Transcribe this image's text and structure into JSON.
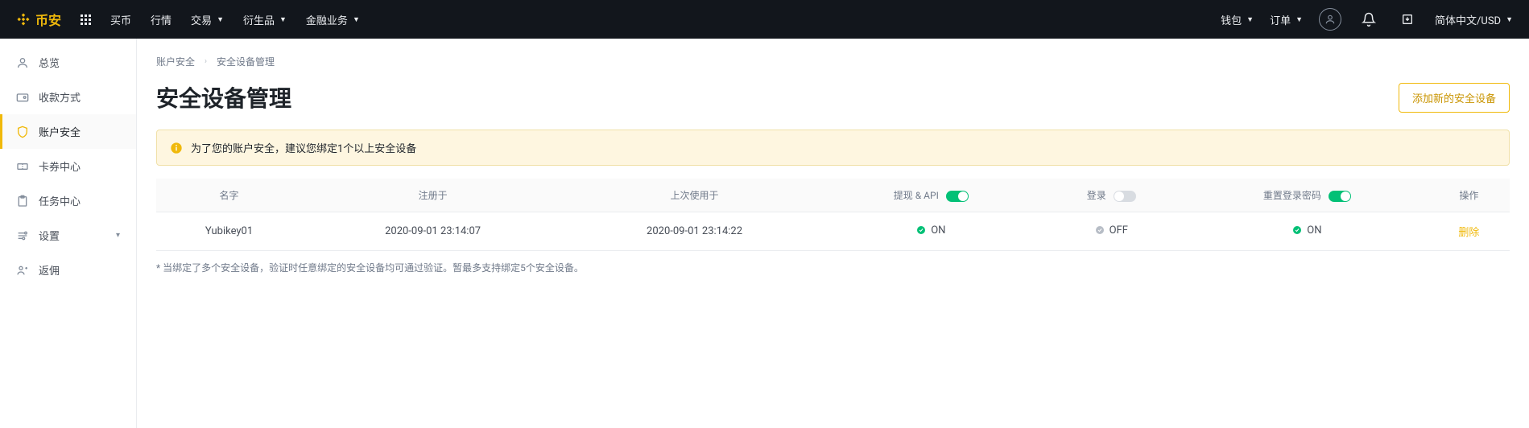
{
  "header": {
    "brand": "币安",
    "nav": [
      "买币",
      "行情",
      "交易",
      "衍生品",
      "金融业务"
    ],
    "wallet": "钱包",
    "orders": "订单",
    "locale": "简体中文/USD"
  },
  "sidebar": {
    "items": [
      {
        "label": "总览"
      },
      {
        "label": "收款方式"
      },
      {
        "label": "账户安全"
      },
      {
        "label": "卡券中心"
      },
      {
        "label": "任务中心"
      },
      {
        "label": "设置"
      },
      {
        "label": "返佣"
      }
    ]
  },
  "breadcrumb": {
    "parent": "账户安全",
    "current": "安全设备管理"
  },
  "page": {
    "title": "安全设备管理",
    "add_button": "添加新的安全设备",
    "alert": "为了您的账户安全，建议您绑定1个以上安全设备",
    "footnote": "* 当绑定了多个安全设备，验证时任意绑定的安全设备均可通过验证。暂最多支持绑定5个安全设备。"
  },
  "table": {
    "headers": {
      "name": "名字",
      "registered": "注册于",
      "last_used": "上次使用于",
      "withdraw_api": "提现 & API",
      "login": "登录",
      "reset_password": "重置登录密码",
      "action": "操作"
    },
    "toggle_states": {
      "withdraw_api": true,
      "login": false,
      "reset_password": true
    },
    "rows": [
      {
        "name": "Yubikey01",
        "registered": "2020-09-01 23:14:07",
        "last_used": "2020-09-01 23:14:22",
        "withdraw_api": "ON",
        "login": "OFF",
        "reset_password": "ON",
        "action": "删除"
      }
    ]
  }
}
